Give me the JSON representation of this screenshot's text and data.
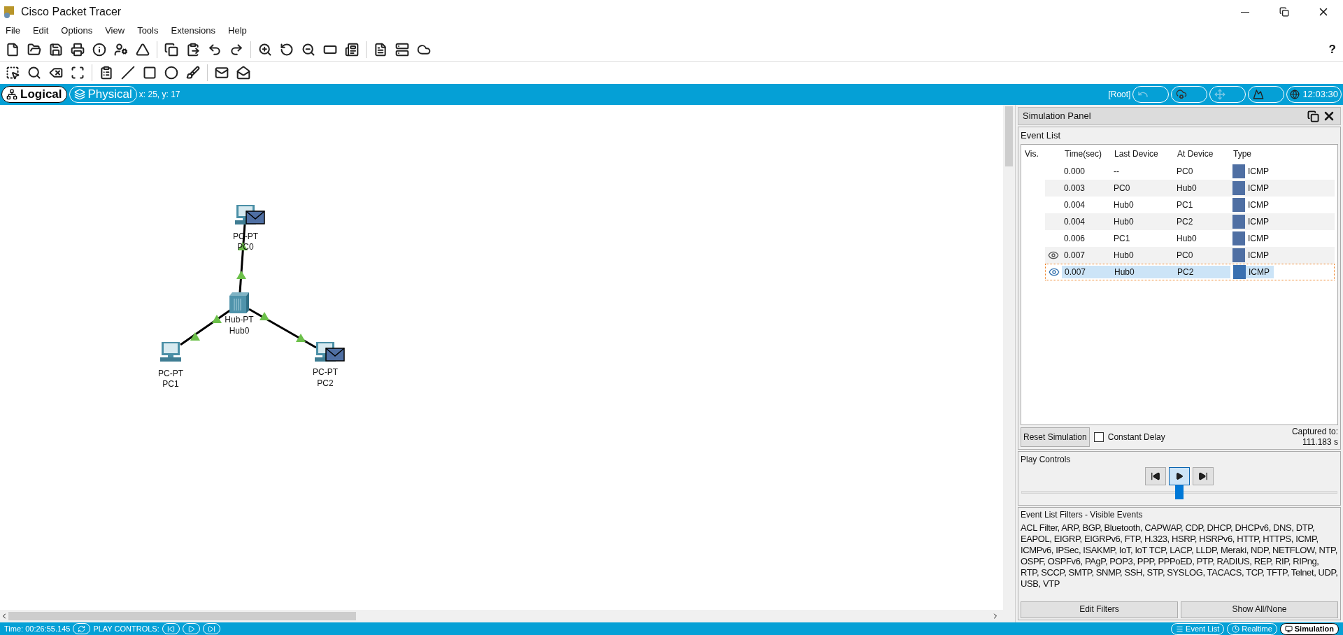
{
  "window": {
    "title": "Cisco Packet Tracer"
  },
  "menu": [
    "File",
    "Edit",
    "Options",
    "View",
    "Tools",
    "Extensions",
    "Help"
  ],
  "toolbar": {
    "help": "?"
  },
  "view_tabs": [
    {
      "label": "Logical",
      "selected": true
    },
    {
      "label": "Physical",
      "selected": false
    }
  ],
  "coordinates": "x: 25, y: 17",
  "breadcrumb": "[Root]",
  "clock": "12:03:30",
  "canvas": {
    "devices": [
      {
        "kind": "pc",
        "model": "PC-PT",
        "name": "PC0",
        "packet": true
      },
      {
        "kind": "hub",
        "model": "Hub-PT",
        "name": "Hub0",
        "packet": false
      },
      {
        "kind": "pc",
        "model": "PC-PT",
        "name": "PC1",
        "packet": false
      },
      {
        "kind": "pc",
        "model": "PC-PT",
        "name": "PC2",
        "packet": true
      }
    ],
    "links": [
      {
        "up": true
      },
      {
        "up": true
      },
      {
        "up": true
      }
    ]
  },
  "simulation_panel": {
    "title": "Simulation Panel",
    "event_list_label": "Event List",
    "columns": [
      "Vis.",
      "Time(sec)",
      "Last Device",
      "At Device",
      "Type"
    ],
    "rows": [
      {
        "eye": false,
        "selected": false,
        "time": "0.000",
        "last_device": "--",
        "at_device": "PC0",
        "type": "ICMP"
      },
      {
        "eye": false,
        "selected": false,
        "time": "0.003",
        "last_device": "PC0",
        "at_device": "Hub0",
        "type": "ICMP"
      },
      {
        "eye": false,
        "selected": false,
        "time": "0.004",
        "last_device": "Hub0",
        "at_device": "PC1",
        "type": "ICMP"
      },
      {
        "eye": false,
        "selected": false,
        "time": "0.004",
        "last_device": "Hub0",
        "at_device": "PC2",
        "type": "ICMP"
      },
      {
        "eye": false,
        "selected": false,
        "time": "0.006",
        "last_device": "PC1",
        "at_device": "Hub0",
        "type": "ICMP"
      },
      {
        "eye": true,
        "selected": false,
        "time": "0.007",
        "last_device": "Hub0",
        "at_device": "PC0",
        "type": "ICMP"
      },
      {
        "eye": true,
        "selected": true,
        "time": "0.007",
        "last_device": "Hub0",
        "at_device": "PC2",
        "type": "ICMP"
      }
    ],
    "reset_button": "Reset Simulation",
    "constant_delay": {
      "label": "Constant Delay",
      "checked": false
    },
    "captured_label": "Captured to:",
    "captured_value": "111.183 s",
    "play_controls_label": "Play Controls",
    "speed": {
      "level": 0.5
    },
    "filters_title": "Event List Filters - Visible Events",
    "filters_text": "ACL Filter, ARP, BGP, Bluetooth, CAPWAP, CDP, DHCP, DHCPv6, DNS, DTP, EAPOL, EIGRP, EIGRPv6, FTP, H.323, HSRP, HSRPv6, HTTP, HTTPS, ICMP, ICMPv6, IPSec, ISAKMP, IoT, IoT TCP, LACP, LLDP, Meraki, NDP, NETFLOW, NTP, OSPF, OSPFv6, PAgP, POP3, PPP, PPPoED, PTP, RADIUS, REP, RIP, RIPng, RTP, SCCP, SMTP, SNMP, SSH, STP, SYSLOG, TACACS, TCP, TFTP, Telnet, UDP, USB, VTP",
    "edit_filters": "Edit Filters",
    "show_all": "Show All/None"
  },
  "status_bar": {
    "time": "Time: 00:26:55.145",
    "play_controls": "PLAY CONTROLS:",
    "mode_tabs": [
      {
        "label": "Event List",
        "selected": false
      },
      {
        "label": "Realtime",
        "selected": false
      },
      {
        "label": "Simulation",
        "selected": true
      }
    ]
  }
}
